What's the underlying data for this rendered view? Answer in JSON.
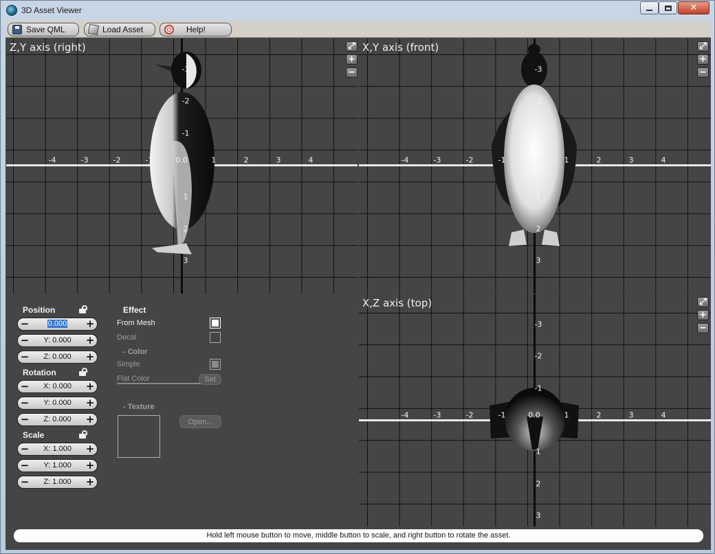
{
  "window": {
    "title": "3D Asset Viewer"
  },
  "toolbar": {
    "save": "Save QML",
    "load": "Load Asset",
    "help": "Help!"
  },
  "views": {
    "right": {
      "title": "Z,Y axis (right)"
    },
    "front": {
      "title": "X,Y axis (front)"
    },
    "top": {
      "title": "X,Z axis (top)"
    }
  },
  "ticks": {
    "x_neg": [
      "-4",
      "-3",
      "-2",
      "-1"
    ],
    "origin": "0.0",
    "x_pos": [
      "1",
      "2",
      "3",
      "4"
    ],
    "y_up": [
      "-3",
      "-2",
      "-1"
    ],
    "y_down": [
      "1",
      "2",
      "3"
    ]
  },
  "controls": {
    "position": {
      "label": "Position",
      "x": "0.000",
      "y": "Y: 0.000",
      "z": "Z: 0.000"
    },
    "rotation": {
      "label": "Rotation",
      "x": "X: 0.000",
      "y": "Y: 0.000",
      "z": "Z: 0.000"
    },
    "scale": {
      "label": "Scale",
      "x": "X: 1.000",
      "y": "Y: 1.000",
      "z": "Z: 1.000"
    }
  },
  "effect": {
    "label": "Effect",
    "from_mesh": "From Mesh",
    "from_mesh_checked": true,
    "decal": "Decal",
    "color_section": "- Color",
    "simple": "Simple",
    "flat_color": "Flat Color",
    "set": "Set",
    "texture_section": "- Texture",
    "open": "Open..."
  },
  "status": "Hold left mouse button to move, middle button to scale, and right button to rotate the asset."
}
